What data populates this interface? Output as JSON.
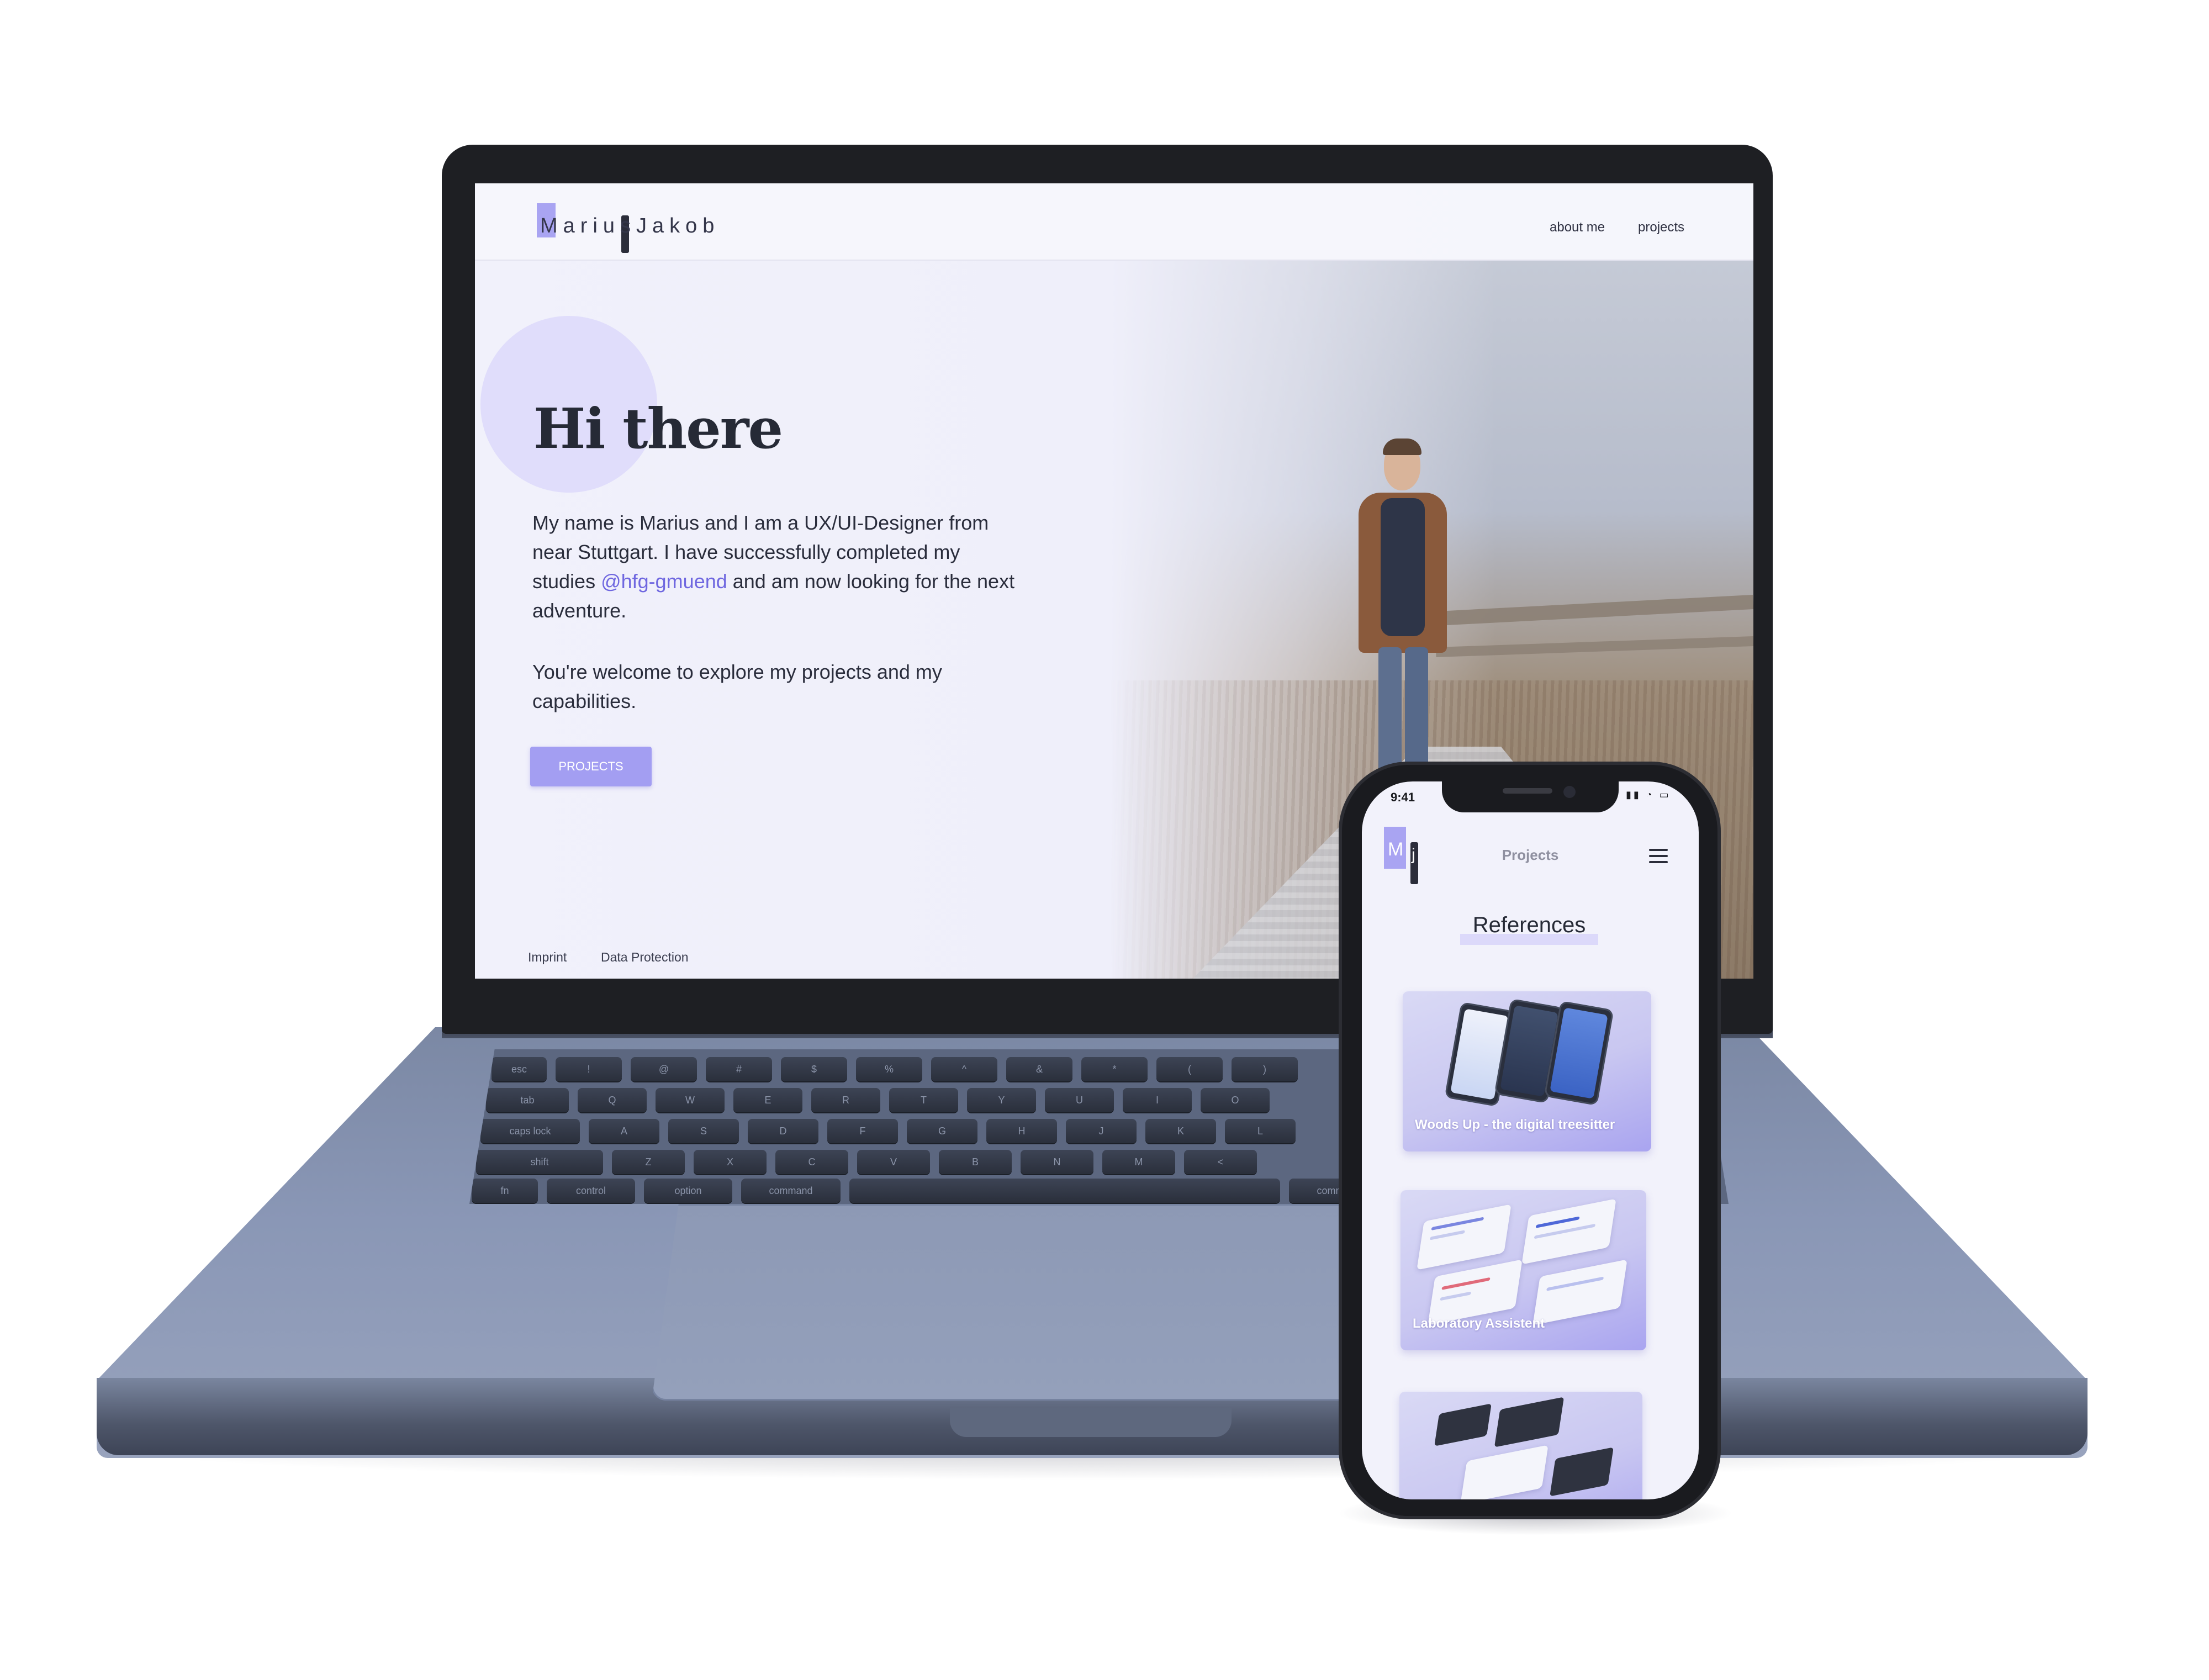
{
  "laptop": {
    "header": {
      "logo_text": "MariusJakob",
      "nav": [
        "about me",
        "projects"
      ]
    },
    "hero": {
      "title": "Hi there",
      "intro_line1": "My name is Marius and I am a UX/UI-Designer from",
      "intro_line2": "near Stuttgart. I have successfully completed my",
      "intro_line3_prefix": "studies ",
      "intro_link": "@hfg-gmuend",
      "intro_line3_suffix": " and am now looking for the next",
      "intro_line4": "adventure.",
      "welcome_line1": "You're welcome to explore my projects and my",
      "welcome_line2": "capabilities.",
      "button_label": "PROJECTS"
    },
    "footer": {
      "imprint": "Imprint",
      "data_protection": "Data Protection"
    },
    "keyboard": {
      "row1": [
        "esc",
        "!",
        "@",
        "#",
        "$",
        "%",
        "^",
        "&",
        "*",
        "(",
        ")"
      ],
      "row2": [
        "tab",
        "Q",
        "W",
        "E",
        "R",
        "T",
        "Y",
        "U",
        "I",
        "O"
      ],
      "row3": [
        "caps lock",
        "A",
        "S",
        "D",
        "F",
        "G",
        "H",
        "J",
        "K",
        "L"
      ],
      "row4": [
        "shift",
        "Z",
        "X",
        "C",
        "V",
        "B",
        "N",
        "M",
        "<"
      ],
      "row5": [
        "fn",
        "control",
        "option",
        "command",
        "",
        "command"
      ]
    }
  },
  "phone": {
    "status": {
      "time": "9:41",
      "icons": "▮▮ ◔ ▭"
    },
    "logo_m": "M",
    "logo_j": "j",
    "nav_title": "Projects",
    "section_title": "References",
    "cards": [
      {
        "label": "Woods Up - the digital treesitter"
      },
      {
        "label": "Laboratory Assistent"
      },
      {
        "label": ""
      }
    ]
  },
  "colors": {
    "accent": "#a39ef2",
    "accent_light": "#e0ddfb",
    "link": "#6f67e0",
    "text_dark": "#262a36",
    "laptop_body": "#8a97b6"
  }
}
